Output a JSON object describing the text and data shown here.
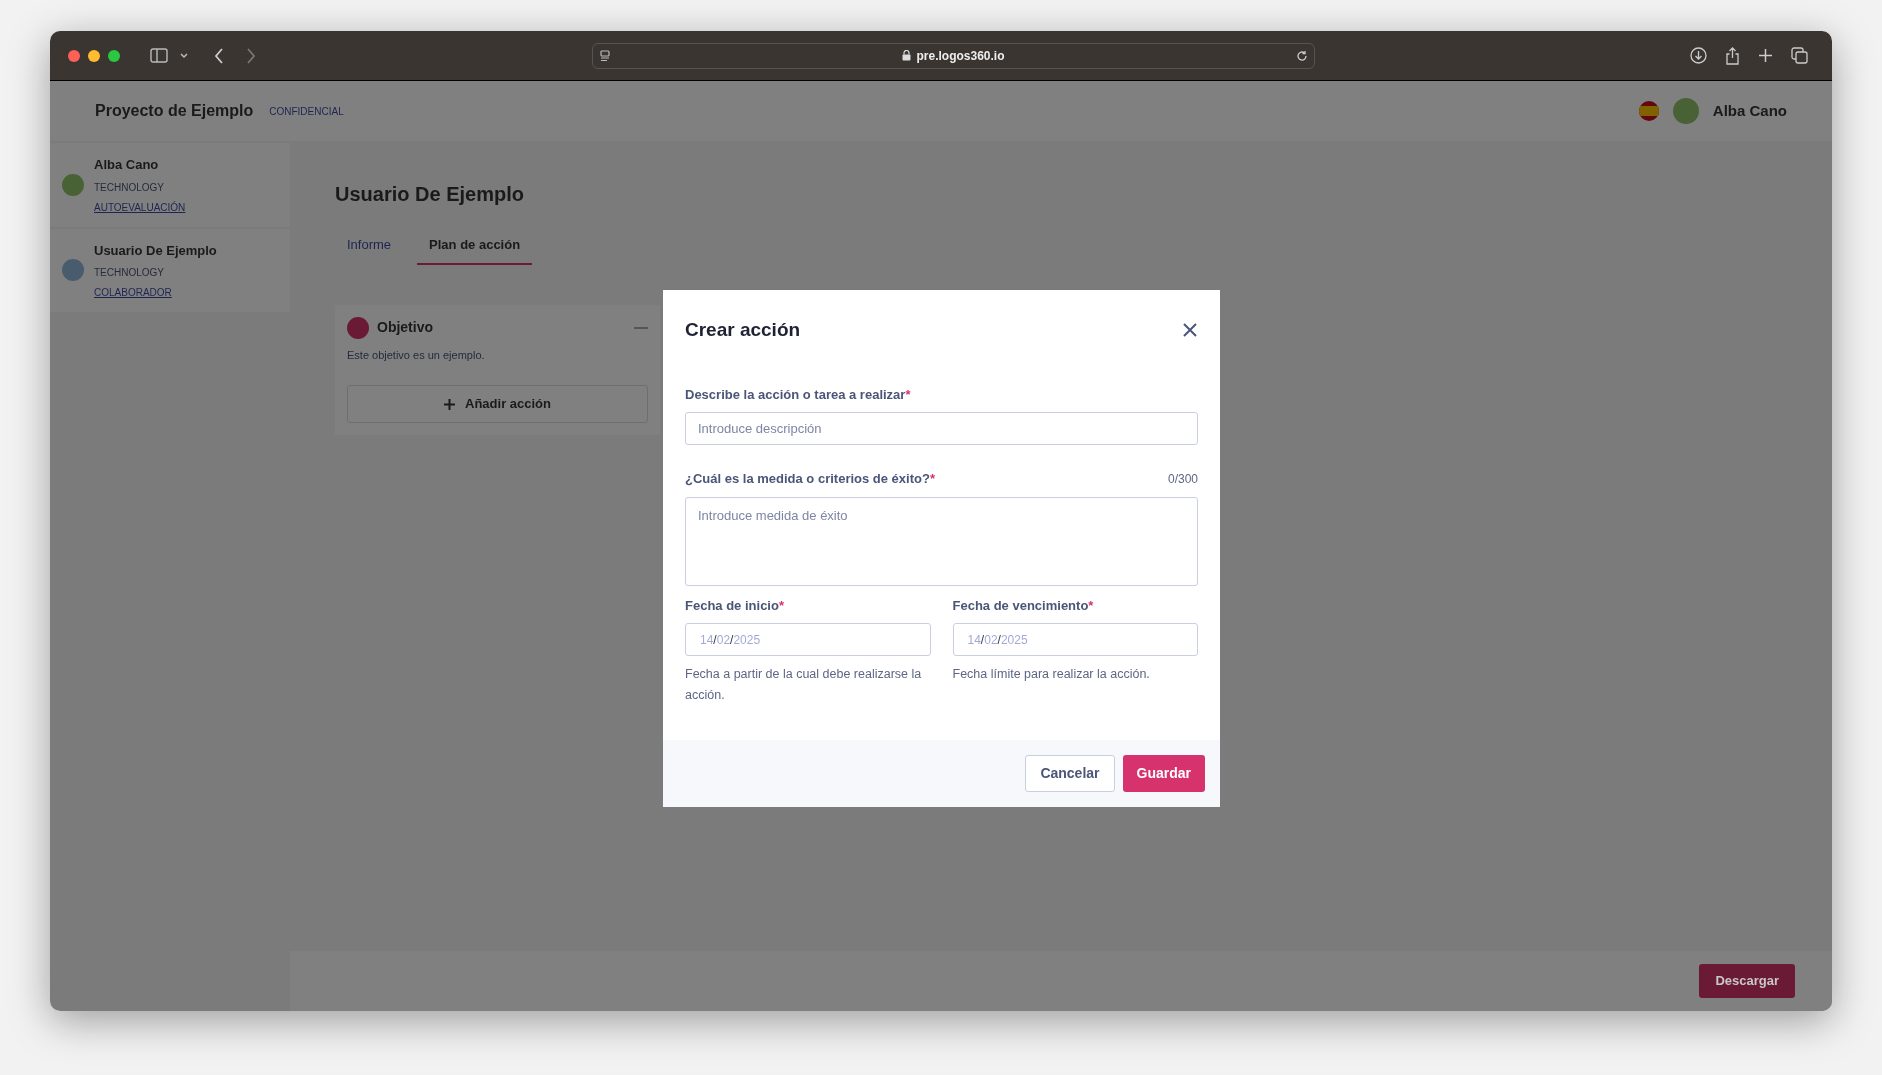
{
  "browser": {
    "url": "pre.logos360.io"
  },
  "app": {
    "project": {
      "name": "Proyecto de Ejemplo",
      "tag": "CONFIDENCIAL"
    },
    "user": {
      "name": "Alba Cano"
    },
    "sidebar": {
      "items": [
        {
          "name": "Alba Cano",
          "team": "TECHNOLOGY",
          "role": "AUTOEVALUACIÓN",
          "color": "#486235"
        },
        {
          "name": "Usuario De Ejemplo",
          "team": "TECHNOLOGY",
          "role": "COLABORADOR",
          "color": "#485c6e"
        }
      ]
    },
    "main": {
      "title": "Usuario De Ejemplo",
      "tabs": [
        {
          "label": "Informe",
          "selected": false
        },
        {
          "label": "Plan de acción",
          "selected": true
        }
      ],
      "objective": {
        "title": "Objetivo",
        "description": "Este objetivo es un ejemplo.",
        "add_button": "Añadir acción"
      }
    },
    "footer": {
      "button": "Descargar"
    }
  },
  "modal": {
    "title": "Crear acción",
    "required_mark": "*",
    "fields": [
      {
        "kind": "text",
        "label": "Describe la acción o tarea a realizar",
        "required": true,
        "placeholder": "Introduce descripción"
      },
      {
        "kind": "textarea",
        "label": "¿Cuál es la medida o criterios de éxito?",
        "required": true,
        "counter": "0/300",
        "placeholder": "Introduce medida de éxito"
      }
    ],
    "date_fields": [
      {
        "label": "Fecha de inicio",
        "required": true,
        "parts": [
          "14",
          "02",
          "2025"
        ],
        "separator": "/",
        "help": "Fecha a partir de la cual debe realizarse la acción."
      },
      {
        "label": "Fecha de vencimiento",
        "required": true,
        "parts": [
          "14",
          "02",
          "2025"
        ],
        "separator": "/",
        "help": "Fecha límite para realizar la acción."
      }
    ],
    "buttons": [
      {
        "label": "Cancelar",
        "kind": "secondary"
      },
      {
        "label": "Guardar",
        "kind": "primary"
      }
    ]
  }
}
